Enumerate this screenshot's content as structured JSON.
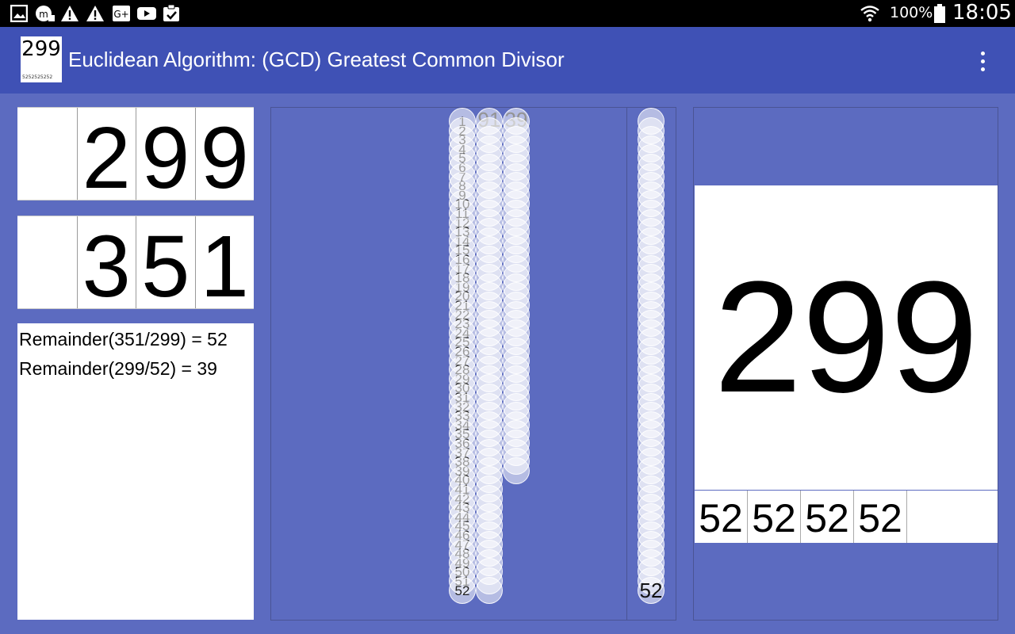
{
  "status_bar": {
    "icons": [
      "image-icon",
      "vpn-icon",
      "warning-icon",
      "warning-icon",
      "google-plus-icon",
      "youtube-icon",
      "clipboard-check-icon"
    ],
    "battery": "100%",
    "time": "18:05"
  },
  "app_bar": {
    "icon_number": "299",
    "icon_caption": "5252525252",
    "title": "Euclidean Algorithm: (GCD) Greatest Common Divisor"
  },
  "number_a": {
    "digits": [
      "",
      "2",
      "9",
      "9"
    ]
  },
  "number_b": {
    "digits": [
      "",
      "3",
      "5",
      "1"
    ]
  },
  "remainders": [
    "Remainder(351/299) = 52",
    "Remainder(299/52) = 39"
  ],
  "visualization": {
    "col1_count": 52,
    "col2_count": 52,
    "col3_count": 39,
    "col2_label": "91",
    "col3_label": "39",
    "col4_count": 52,
    "col4_label": "52"
  },
  "result": {
    "value": "299",
    "remainder_cells": [
      "52",
      "52",
      "52",
      "52",
      ""
    ]
  }
}
